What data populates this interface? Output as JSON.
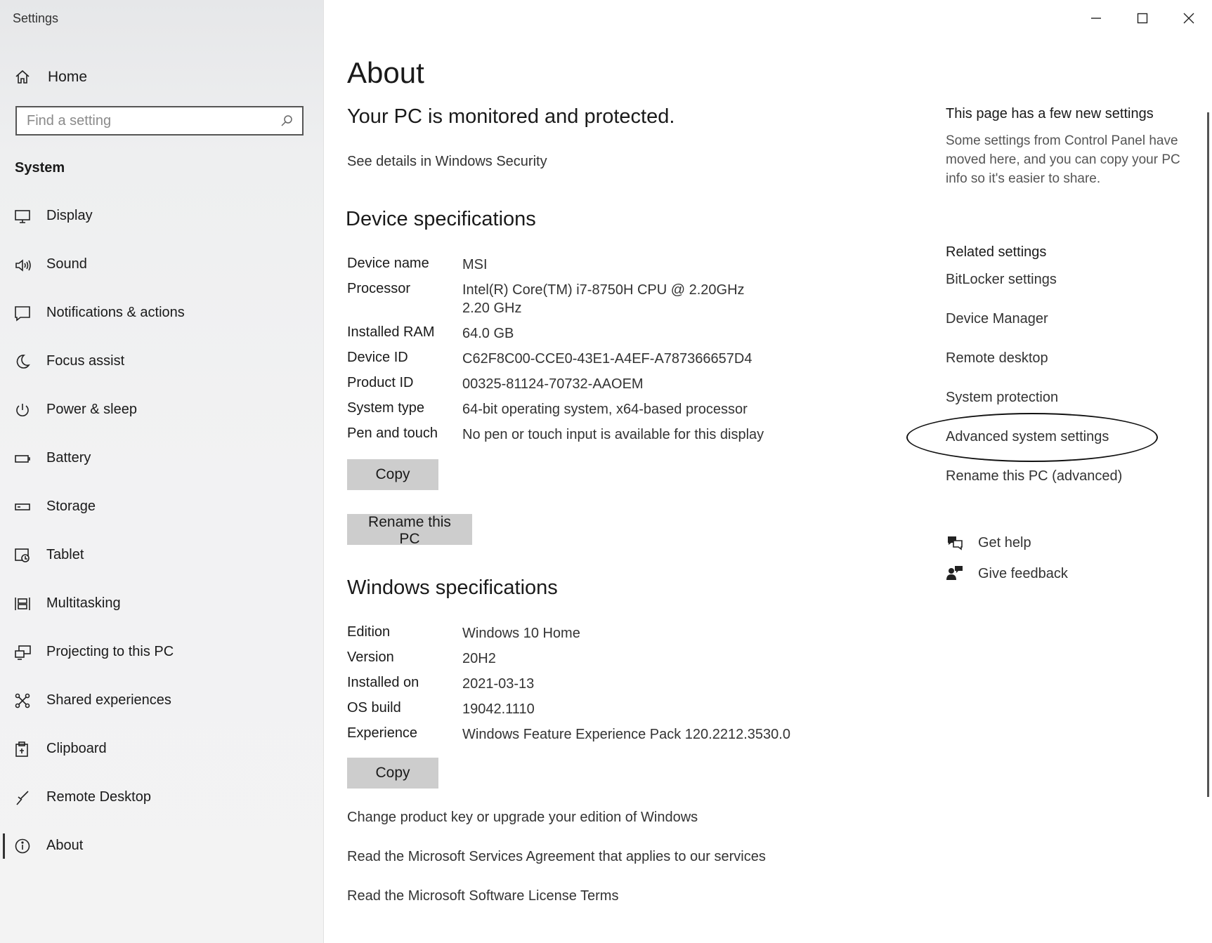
{
  "window": {
    "title": "Settings",
    "controls": [
      "minimize-icon",
      "maximize-icon",
      "close-icon"
    ]
  },
  "sidebar": {
    "home_label": "Home",
    "search_placeholder": "Find a setting",
    "section_title": "System",
    "items": [
      {
        "label": "Display",
        "icon": "display-icon"
      },
      {
        "label": "Sound",
        "icon": "sound-icon"
      },
      {
        "label": "Notifications & actions",
        "icon": "notifications-icon"
      },
      {
        "label": "Focus assist",
        "icon": "focus-assist-icon"
      },
      {
        "label": "Power & sleep",
        "icon": "power-icon"
      },
      {
        "label": "Battery",
        "icon": "battery-icon"
      },
      {
        "label": "Storage",
        "icon": "storage-icon"
      },
      {
        "label": "Tablet",
        "icon": "tablet-icon"
      },
      {
        "label": "Multitasking",
        "icon": "multitasking-icon"
      },
      {
        "label": "Projecting to this PC",
        "icon": "projecting-icon"
      },
      {
        "label": "Shared experiences",
        "icon": "shared-experiences-icon"
      },
      {
        "label": "Clipboard",
        "icon": "clipboard-icon"
      },
      {
        "label": "Remote Desktop",
        "icon": "remote-desktop-icon"
      },
      {
        "label": "About",
        "icon": "info-icon",
        "active": true
      }
    ]
  },
  "main": {
    "title": "About",
    "protection_status": "Your PC is monitored and protected.",
    "security_link": "See details in Windows Security",
    "device_specs": {
      "heading": "Device specifications",
      "rows": [
        {
          "key": "Device name",
          "value": "MSI"
        },
        {
          "key": "Processor",
          "value": "Intel(R) Core(TM) i7-8750H CPU @ 2.20GHz   2.20 GHz"
        },
        {
          "key": "Installed RAM",
          "value": "64.0 GB"
        },
        {
          "key": "Device ID",
          "value": "C62F8C00-CCE0-43E1-A4EF-A787366657D4"
        },
        {
          "key": "Product ID",
          "value": "00325-81124-70732-AAOEM"
        },
        {
          "key": "System type",
          "value": "64-bit operating system, x64-based processor"
        },
        {
          "key": "Pen and touch",
          "value": "No pen or touch input is available for this display"
        }
      ],
      "copy_label": "Copy",
      "rename_label": "Rename this PC"
    },
    "windows_specs": {
      "heading": "Windows specifications",
      "rows": [
        {
          "key": "Edition",
          "value": "Windows 10 Home"
        },
        {
          "key": "Version",
          "value": "20H2"
        },
        {
          "key": "Installed on",
          "value": "2021-03-13"
        },
        {
          "key": "OS build",
          "value": "19042.1110"
        },
        {
          "key": "Experience",
          "value": "Windows Feature Experience Pack 120.2212.3530.0"
        }
      ],
      "copy_label": "Copy"
    },
    "links": [
      "Change product key or upgrade your edition of Windows",
      "Read the Microsoft Services Agreement that applies to our services",
      "Read the Microsoft Software License Terms"
    ]
  },
  "right": {
    "notice_heading": "This page has a few new settings",
    "notice_text": "Some settings from Control Panel have moved here, and you can copy your PC info so it's easier to share.",
    "related_heading": "Related settings",
    "related_links": [
      "BitLocker settings",
      "Device Manager",
      "Remote desktop",
      "System protection",
      "Advanced system settings",
      "Rename this PC (advanced)"
    ],
    "get_help": "Get help",
    "give_feedback": "Give feedback"
  }
}
